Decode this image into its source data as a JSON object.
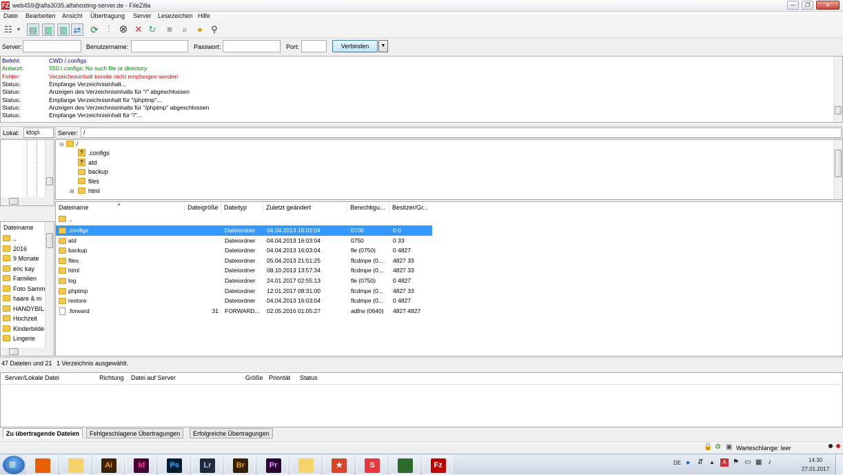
{
  "window": {
    "title": "web459@alfa3035.alfahosting-server.de - FileZilla",
    "logo_text": "FZ",
    "buttons": [
      "—",
      "❐",
      "✕"
    ]
  },
  "menu": [
    "Datei",
    "Bearbeiten",
    "Ansicht",
    "Übertragung",
    "Server",
    "Lesezeichen",
    "Hilfe"
  ],
  "quickconnect": {
    "server_label": "Server:",
    "user_label": "Benutzername:",
    "pass_label": "Passwort:",
    "port_label": "Port:",
    "server_value": "",
    "user_value": "",
    "pass_value": "",
    "port_value": "",
    "connect_label": "Verbinden"
  },
  "log": [
    {
      "type": "Befehl:",
      "msg": "CWD /.configs",
      "cls": "c-cmd"
    },
    {
      "type": "Antwort:",
      "msg": "550 /.configs: No such file or directory",
      "cls": "c-resp"
    },
    {
      "type": "Fehler:",
      "msg": "Verzeichnisinhalt konnte nicht empfangen werden",
      "cls": "c-err"
    },
    {
      "type": "Status:",
      "msg": "Empfange Verzeichnisinhalt...",
      "cls": "c-stat"
    },
    {
      "type": "Status:",
      "msg": "Anzeigen des Verzeichnisinhalts für \"/\" abgeschlossen",
      "cls": "c-stat"
    },
    {
      "type": "Status:",
      "msg": "Empfange Verzeichnisinhalt für \"/phptmp\"...",
      "cls": "c-stat"
    },
    {
      "type": "Status:",
      "msg": "Anzeigen des Verzeichnisinhalts für \"/phptmp\" abgeschlossen",
      "cls": "c-stat"
    },
    {
      "type": "Status:",
      "msg": "Empfange Verzeichnisinhalt für \"/\"...",
      "cls": "c-stat"
    }
  ],
  "local": {
    "label": "Lokal:",
    "path": "ktop\\",
    "list_header": "Dateiname",
    "items": [
      "..",
      "2016",
      "9 Monate",
      "eric kay",
      "Familien",
      "Foto Samm",
      "haare & m",
      "HANDYBIL",
      "Hochzeit",
      "Kinderbilde",
      "Lingerie"
    ],
    "status": "47 Dateien und 21"
  },
  "server": {
    "label": "Server:",
    "path": "/",
    "tree_root": "/",
    "tree": [
      {
        "name": ".configs",
        "icon": "question-folder"
      },
      {
        "name": "atd",
        "icon": "question-folder"
      },
      {
        "name": "backup",
        "icon": "folder"
      },
      {
        "name": "files",
        "icon": "folder"
      },
      {
        "name": "html",
        "icon": "folder"
      }
    ],
    "headers": [
      "Dateiname",
      "Dateigröße",
      "Dateityp",
      "Zuletzt geändert",
      "Berechtigu...",
      "Besitzer/Gr..."
    ],
    "parent": "..",
    "files": [
      {
        "name": ".configs",
        "size": "",
        "type": "Dateiordner",
        "modified": "04.04.2013 16:03:04",
        "perm": "0700",
        "owner": "0 0",
        "icon": "folder",
        "selected": true
      },
      {
        "name": "atd",
        "size": "",
        "type": "Dateiordner",
        "modified": "04.04.2013 16:03:04",
        "perm": "0750",
        "owner": "0 33",
        "icon": "folder"
      },
      {
        "name": "backup",
        "size": "",
        "type": "Dateiordner",
        "modified": "04.04.2013 16:03:04",
        "perm": "fle (0750)",
        "owner": "0 4827",
        "icon": "folder"
      },
      {
        "name": "files",
        "size": "",
        "type": "Dateiordner",
        "modified": "05.04.2013 21:51:25",
        "perm": "flcdmpe (0...",
        "owner": "4827 33",
        "icon": "folder"
      },
      {
        "name": "html",
        "size": "",
        "type": "Dateiordner",
        "modified": "08.10.2013 13:57:34",
        "perm": "flcdmpe (0...",
        "owner": "4827 33",
        "icon": "folder"
      },
      {
        "name": "log",
        "size": "",
        "type": "Dateiordner",
        "modified": "24.01.2017 02:55:13",
        "perm": "fle (0750)",
        "owner": "0 4827",
        "icon": "folder"
      },
      {
        "name": "phptmp",
        "size": "",
        "type": "Dateiordner",
        "modified": "12.01.2017 08:31:00",
        "perm": "flcdmpe (0...",
        "owner": "4827 33",
        "icon": "folder"
      },
      {
        "name": "restore",
        "size": "",
        "type": "Dateiordner",
        "modified": "04.04.2013 16:03:04",
        "perm": "flcdmpe (0...",
        "owner": "0 4827",
        "icon": "folder"
      },
      {
        "name": ".forward",
        "size": "31",
        "type": "FORWARD...",
        "modified": "02.05.2016 01:05:27",
        "perm": "adfrw (0640)",
        "owner": "4827 4827",
        "icon": "file"
      }
    ],
    "status": "1 Verzeichnis ausgewählt."
  },
  "queue": {
    "headers": [
      "Server/Lokale Datei",
      "Richtung",
      "Datei auf Server",
      "Größe",
      "Priorität",
      "Status"
    ],
    "tabs": [
      "Zu übertragende Dateien",
      "Fehlgeschlagene Übertragungen",
      "Erfolgreiche Übertragungen"
    ]
  },
  "statusbar": {
    "queue_text": "Warteschlange: leer"
  },
  "taskbar": {
    "apps": [
      {
        "name": "firefox",
        "label": "",
        "bg": "#e66000",
        "fg": "#fff"
      },
      {
        "name": "explorer",
        "label": "",
        "bg": "#f4d36b",
        "fg": "#333"
      },
      {
        "name": "illustrator",
        "label": "Ai",
        "bg": "#3b2203",
        "fg": "#ff9a00"
      },
      {
        "name": "indesign",
        "label": "Id",
        "bg": "#470137",
        "fg": "#ff3f94"
      },
      {
        "name": "photoshop",
        "label": "Ps",
        "bg": "#001d34",
        "fg": "#31a8ff"
      },
      {
        "name": "lightroom",
        "label": "Lr",
        "bg": "#1c2c3c",
        "fg": "#b0c8e0"
      },
      {
        "name": "bridge",
        "label": "Br",
        "bg": "#332000",
        "fg": "#e5a000"
      },
      {
        "name": "premiere",
        "label": "Pr",
        "bg": "#2a0634",
        "fg": "#e69bff"
      },
      {
        "name": "mail",
        "label": "",
        "bg": "#f7d46a",
        "fg": "#333"
      },
      {
        "name": "bookmark",
        "label": "★",
        "bg": "#d9452b",
        "fg": "#fff"
      },
      {
        "name": "s-app",
        "label": "S",
        "bg": "#e8383d",
        "fg": "#fff"
      },
      {
        "name": "terminal",
        "label": "",
        "bg": "#2d6b2d",
        "fg": "#fff"
      },
      {
        "name": "filezilla",
        "label": "Fz",
        "bg": "#bf0000",
        "fg": "#fff"
      }
    ],
    "lang": "DE",
    "time": "14:30",
    "date": "27.01.2017"
  }
}
